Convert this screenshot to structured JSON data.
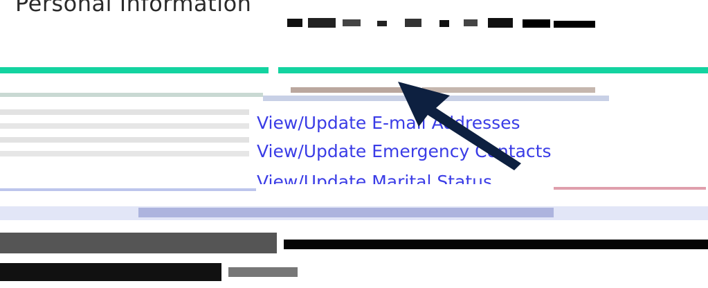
{
  "page": {
    "title": "Personal Information"
  },
  "links": {
    "email": "View/Update E-mail Addresses",
    "emergency": "View/Update Emergency Contacts",
    "marital": "View/Update Marital Status"
  },
  "colors": {
    "accent_bar": "#13d3a0",
    "link": "#3a3ce6",
    "arrow": "#0d2040"
  },
  "annotation": {
    "arrow_icon": "arrow-pointing-icon"
  }
}
